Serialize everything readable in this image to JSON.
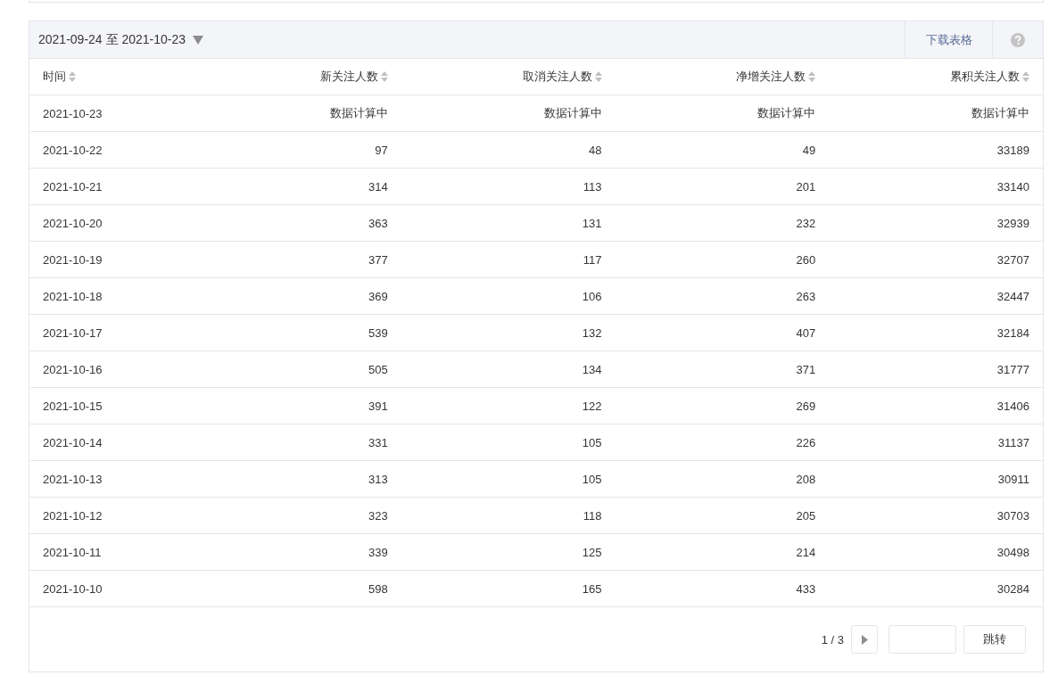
{
  "date_range": {
    "label": "2021-09-24 至 2021-10-23"
  },
  "toolbar": {
    "download": "下载表格"
  },
  "table": {
    "columns": [
      {
        "label": "时间"
      },
      {
        "label": "新关注人数"
      },
      {
        "label": "取消关注人数"
      },
      {
        "label": "净增关注人数"
      },
      {
        "label": "累积关注人数"
      }
    ],
    "rows": [
      [
        "2021-10-23",
        "数据计算中",
        "数据计算中",
        "数据计算中",
        "数据计算中"
      ],
      [
        "2021-10-22",
        "97",
        "48",
        "49",
        "33189"
      ],
      [
        "2021-10-21",
        "314",
        "113",
        "201",
        "33140"
      ],
      [
        "2021-10-20",
        "363",
        "131",
        "232",
        "32939"
      ],
      [
        "2021-10-19",
        "377",
        "117",
        "260",
        "32707"
      ],
      [
        "2021-10-18",
        "369",
        "106",
        "263",
        "32447"
      ],
      [
        "2021-10-17",
        "539",
        "132",
        "407",
        "32184"
      ],
      [
        "2021-10-16",
        "505",
        "134",
        "371",
        "31777"
      ],
      [
        "2021-10-15",
        "391",
        "122",
        "269",
        "31406"
      ],
      [
        "2021-10-14",
        "331",
        "105",
        "226",
        "31137"
      ],
      [
        "2021-10-13",
        "313",
        "105",
        "208",
        "30911"
      ],
      [
        "2021-10-12",
        "323",
        "118",
        "205",
        "30703"
      ],
      [
        "2021-10-11",
        "339",
        "125",
        "214",
        "30498"
      ],
      [
        "2021-10-10",
        "598",
        "165",
        "433",
        "30284"
      ]
    ]
  },
  "pagination": {
    "page": "1 / 3",
    "jump": "跳转"
  }
}
